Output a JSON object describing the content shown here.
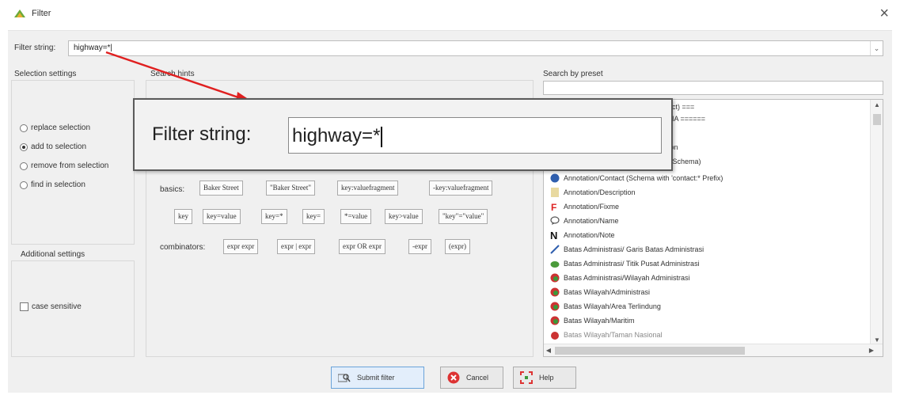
{
  "window": {
    "title": "Filter",
    "close": "×"
  },
  "filter": {
    "label": "Filter string:",
    "value": "highway=*|",
    "dropdown": "⌄"
  },
  "selection": {
    "title": "Selection settings",
    "options": [
      "replace selection",
      "add to selection",
      "remove from selection",
      "find in selection"
    ],
    "selected_index": 1
  },
  "additional": {
    "title": "Additional settings",
    "case_sensitive": "case sensitive"
  },
  "hints": {
    "title": "Search hints",
    "basics_label": "basics:",
    "basics": [
      "Baker Street",
      "\"Baker Street\"",
      "key:valuefragment",
      "-key:valuefragment"
    ],
    "row2": [
      "key",
      "key=value",
      "key=*",
      "key=",
      "*=value",
      "key>value",
      "\"key\"=\"value\""
    ],
    "combinators_label": "combinators:",
    "combinators": [
      "expr expr",
      "expr | expr",
      "expr OR expr",
      "-expr",
      "(expr)"
    ]
  },
  "preset": {
    "title": "Search by preset",
    "items": [
      "oject) ===",
      "ESIA ======",
      "ation",
      "on Schema)",
      "Annotation/Contact (Schema with 'contact:* Prefix)",
      "Annotation/Description",
      "Annotation/Fixme",
      "Annotation/Name",
      "Annotation/Note",
      "Batas Administrasi/ Garis Batas Administrasi",
      "Batas Administrasi/ Titik Pusat Administrasi",
      "Batas Administrasi/Wilayah Administrasi",
      "Batas Wilayah/Administrasi",
      "Batas Wilayah/Area Terlindung",
      "Batas Wilayah/Maritim",
      "Batas Wilayah/Taman Nasional"
    ]
  },
  "zoom_callout": {
    "label": "Filter string:",
    "value": "highway=*"
  },
  "buttons": {
    "submit": "Submit filter",
    "cancel": "Cancel",
    "help": "Help"
  },
  "colors": {
    "arrow": "#e02020",
    "accent": "#6aa3d9"
  }
}
